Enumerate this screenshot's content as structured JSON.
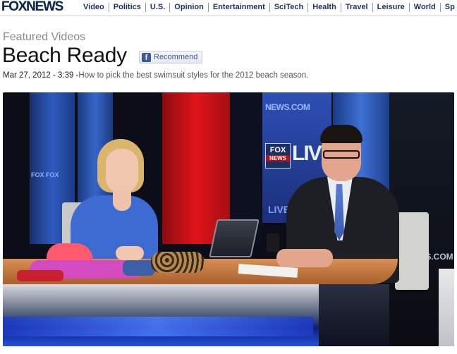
{
  "header": {
    "logo": "FOXNEWS",
    "nav": [
      "Video",
      "Politics",
      "U.S.",
      "Opinion",
      "Entertainment",
      "SciTech",
      "Health",
      "Travel",
      "Leisure",
      "World",
      "Sp"
    ]
  },
  "page": {
    "kicker": "Featured Videos",
    "title": "Beach Ready",
    "recommend_label": "Recommend",
    "fb_glyph": "f",
    "date_duration": "Mar 27, 2012 - 3:39 -",
    "description": "How to pick the best swimsuit styles for the 2012 beach season."
  },
  "video": {
    "screen_text_top": "NEWS.COM",
    "screen_fox": "FOX",
    "screen_news": "NEWS",
    "screen_live": "LIV",
    "screen_live_bottom": "LIVE",
    "wall_left": "FOX FOX",
    "wall_right": "WS.COM"
  }
}
